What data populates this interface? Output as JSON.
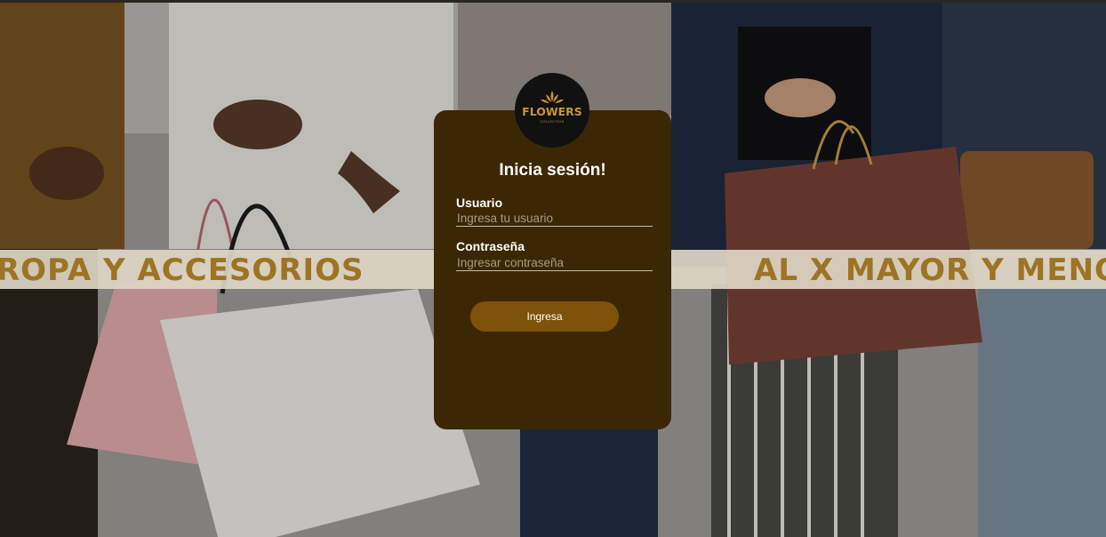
{
  "banner": {
    "left_text": "ROPA Y ACCESORIOS",
    "right_text": "AL X MAYOR Y MENO"
  },
  "logo": {
    "brand": "FLOWERS",
    "sub": "COLLECTION"
  },
  "login": {
    "title": "Inicia sesión!",
    "user_label": "Usuario",
    "user_placeholder": "Ingresa tu usuario",
    "user_value": "",
    "password_label": "Contraseña",
    "password_placeholder": "Ingresar contraseña",
    "password_value": "",
    "submit_label": "Ingresa"
  },
  "colors": {
    "card_background": "#3c2704",
    "button_background": "#7e520b",
    "banner_text": "#9c7424",
    "logo_gold": "#c99536"
  }
}
